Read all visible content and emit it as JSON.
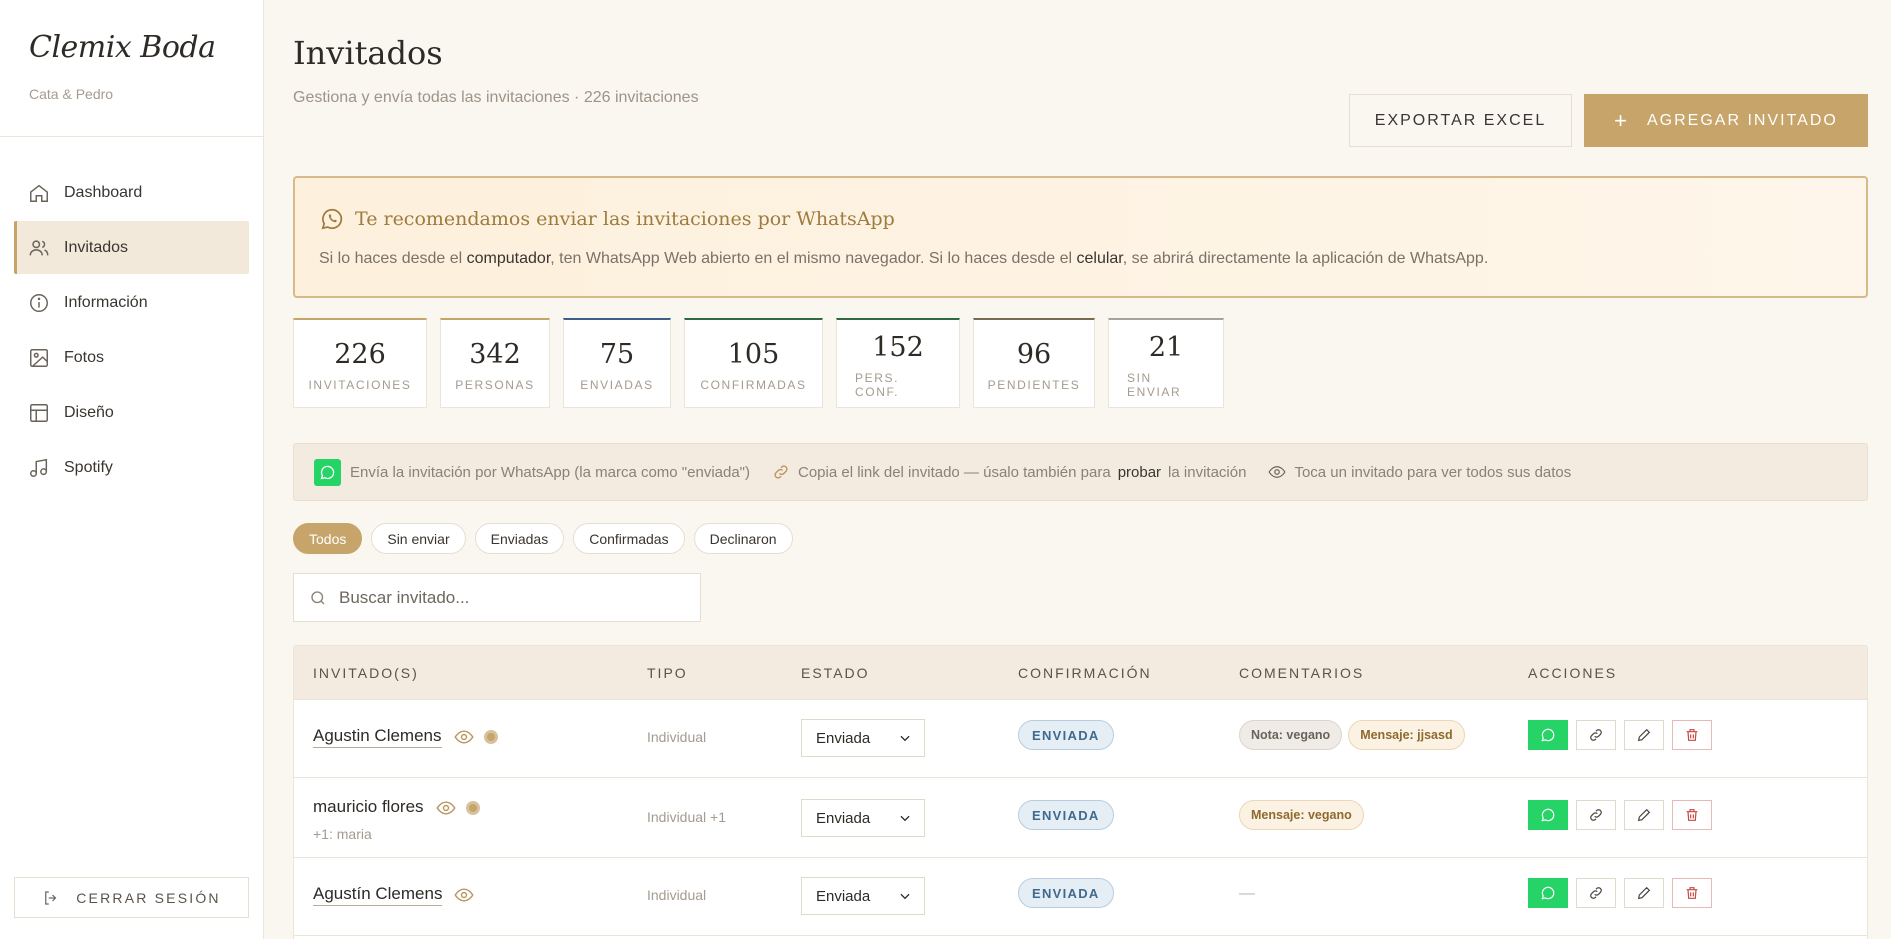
{
  "sidebar": {
    "brand": "Clemix Boda",
    "couple": "Cata & Pedro",
    "items": [
      {
        "label": "Dashboard",
        "icon": "home-icon",
        "active": false
      },
      {
        "label": "Invitados",
        "icon": "users-icon",
        "active": true
      },
      {
        "label": "Información",
        "icon": "info-icon",
        "active": false
      },
      {
        "label": "Fotos",
        "icon": "image-icon",
        "active": false
      },
      {
        "label": "Diseño",
        "icon": "layout-icon",
        "active": false
      },
      {
        "label": "Spotify",
        "icon": "music-icon",
        "active": false
      }
    ],
    "logout_label": "CERRAR SESIÓN"
  },
  "header": {
    "title": "Invitados",
    "subtitle": "Gestiona y envía todas las invitaciones · 226 invitaciones",
    "export_label": "EXPORTAR EXCEL",
    "add_label": "AGREGAR INVITADO"
  },
  "banner": {
    "title": "Te recomendamos enviar las invitaciones por WhatsApp",
    "text_1": "Si lo haces desde el ",
    "text_b1": "computador",
    "text_2": ", ten WhatsApp Web abierto en el mismo navegador. Si lo haces desde el ",
    "text_b2": "celular",
    "text_3": ", se abrirá directamente la aplicación de WhatsApp."
  },
  "stats": [
    {
      "value": "226",
      "label": "INVITACIONES",
      "accent": "#c6a46a"
    },
    {
      "value": "342",
      "label": "PERSONAS",
      "accent": "#c6a46a"
    },
    {
      "value": "75",
      "label": "ENVIADAS",
      "accent": "#3b5f86"
    },
    {
      "value": "105",
      "label": "CONFIRMADAS",
      "accent": "#2f6b3f"
    },
    {
      "value": "152",
      "label": "PERS. CONF.",
      "accent": "#2f6b3f"
    },
    {
      "value": "96",
      "label": "PENDIENTES",
      "accent": "#7a6a52"
    },
    {
      "value": "21",
      "label": "SIN ENVIAR",
      "accent": "#a7a29b"
    }
  ],
  "help": {
    "wa_text": "Envía la invitación por WhatsApp (la marca como \"enviada\")",
    "link_text_1": "Copia el link del invitado — úsalo también para",
    "link_strong": "probar",
    "link_text_2": "la invitación",
    "eye_text": "Toca un invitado para ver todos sus datos"
  },
  "filters": [
    "Todos",
    "Sin enviar",
    "Enviadas",
    "Confirmadas",
    "Declinaron"
  ],
  "search": {
    "placeholder": "Buscar invitado..."
  },
  "table": {
    "headers": [
      "INVITADO(S)",
      "TIPO",
      "ESTADO",
      "CONFIRMACIÓN",
      "COMENTARIOS",
      "ACCIONES"
    ],
    "rows": [
      {
        "name": "Agustin Clemens",
        "plus": "",
        "tipo": "Individual",
        "estado": "Enviada",
        "confirmacion": "ENVIADA",
        "tags": [
          {
            "kind": "note",
            "text": "Nota: vegano"
          },
          {
            "kind": "msg",
            "text": "Mensaje: jjsasd"
          }
        ]
      },
      {
        "name": "mauricio flores",
        "plus": "+1: maria",
        "tipo": "Individual +1",
        "estado": "Enviada",
        "confirmacion": "ENVIADA",
        "tags": [
          {
            "kind": "msg",
            "text": "Mensaje: vegano"
          }
        ]
      },
      {
        "name": "Agustín Clemens",
        "plus": "",
        "tipo": "Individual",
        "estado": "Enviada",
        "confirmacion": "ENVIADA",
        "tags": [],
        "empty": "—"
      }
    ]
  }
}
